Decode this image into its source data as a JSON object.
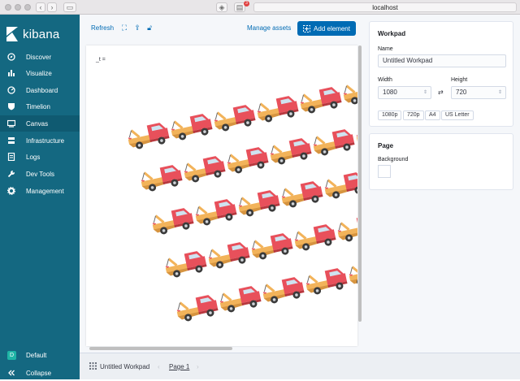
{
  "browser": {
    "url": "localhost",
    "notification_count": "3"
  },
  "sidebar": {
    "brand": "kibana",
    "items": [
      {
        "label": "Discover",
        "icon": "compass-icon"
      },
      {
        "label": "Visualize",
        "icon": "bar-chart-icon"
      },
      {
        "label": "Dashboard",
        "icon": "dashboard-icon"
      },
      {
        "label": "Timelion",
        "icon": "shield-icon"
      },
      {
        "label": "Canvas",
        "icon": "canvas-icon"
      },
      {
        "label": "Infrastructure",
        "icon": "infrastructure-icon"
      },
      {
        "label": "Logs",
        "icon": "logs-icon"
      },
      {
        "label": "Dev Tools",
        "icon": "wrench-icon"
      },
      {
        "label": "Management",
        "icon": "gear-icon"
      }
    ],
    "space_initial": "D",
    "space_label": "Default",
    "collapse_label": "Collapse"
  },
  "toolbar": {
    "refresh_label": "Refresh",
    "manage_assets_label": "Manage assets",
    "add_element_label": "Add element"
  },
  "canvas": {
    "element_text": "_t ="
  },
  "footer": {
    "workpad_name": "Untitled Workpad",
    "page_label": "Page 1"
  },
  "workpad_panel": {
    "title": "Workpad",
    "name_label": "Name",
    "name_value": "Untitled Workpad",
    "width_label": "Width",
    "width_value": "1080",
    "height_label": "Height",
    "height_value": "720",
    "presets": [
      "1080p",
      "720p",
      "A4",
      "US Letter"
    ]
  },
  "page_panel": {
    "title": "Page",
    "background_label": "Background"
  },
  "colors": {
    "sidebar": "#146881",
    "accent": "#006bb4",
    "truck_cab": "#e8505b",
    "truck_bed": "#f2b35a",
    "wheel": "#3b3b3b"
  }
}
